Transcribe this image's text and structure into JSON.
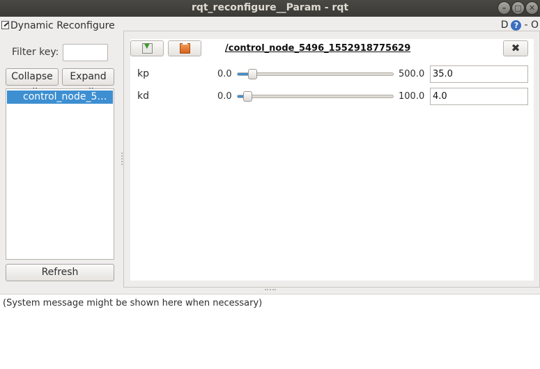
{
  "window": {
    "title": "rqt_reconfigure__Param - rqt"
  },
  "window_buttons": {
    "minimize": "–",
    "maximize": "□",
    "close": "✕"
  },
  "plugin": {
    "title": "Dynamic Reconfigure",
    "help_label": "D",
    "help_icon": "?",
    "extra_label": "- O"
  },
  "filter": {
    "label": "Filter key:",
    "value": ""
  },
  "buttons": {
    "collapse_all": "Collapse all",
    "expand_all": "Expand all",
    "refresh": "Refresh"
  },
  "tree": {
    "items": [
      {
        "label": "control_node_5…",
        "selected": true
      }
    ]
  },
  "editor": {
    "node_name": "/control_node_5496_1552918775629",
    "close_icon": "✖",
    "params": [
      {
        "name": "kp",
        "min": "0.0",
        "max": "500.0",
        "value": "35.0",
        "fraction": 0.07
      },
      {
        "name": "kd",
        "min": "0.0",
        "max": "100.0",
        "value": "4.0",
        "fraction": 0.04
      }
    ]
  },
  "status": {
    "message": "(System message might be shown here when necessary)"
  },
  "colors": {
    "accent": "#3d8fd1",
    "titlebar": "#3b3a36",
    "panel": "#efedec"
  }
}
